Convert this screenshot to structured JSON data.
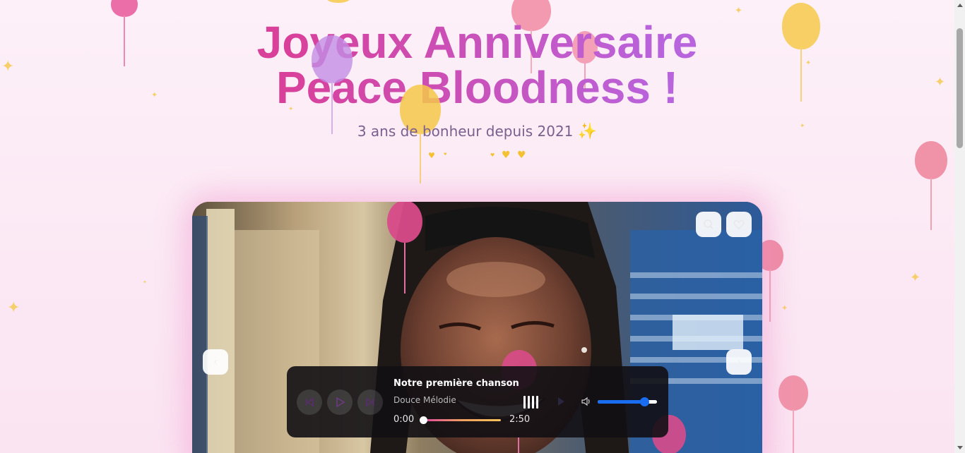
{
  "header": {
    "title_line1": "Joyeux Anniversaire",
    "title_line2": "Peace Bloodness !",
    "subtitle": "3 ans de bonheur depuis 2021",
    "subtitle_emoji": "✨"
  },
  "photo_card": {
    "zoom_icon": "zoom-icon",
    "heart_icon": "heart-icon",
    "prev_icon": "chevron-left-icon",
    "next_icon": "chevron-right-icon"
  },
  "player": {
    "song_title": "Notre première chanson",
    "artist": "Douce Mélodie",
    "current_time": "0:00",
    "duration": "2:50",
    "progress": 0.0,
    "volume": 0.78,
    "accent": "#1a6cf0"
  },
  "colors": {
    "title_pink": "#d9409a",
    "title_purple": "#b864dd",
    "background": "#fdf0f8"
  }
}
